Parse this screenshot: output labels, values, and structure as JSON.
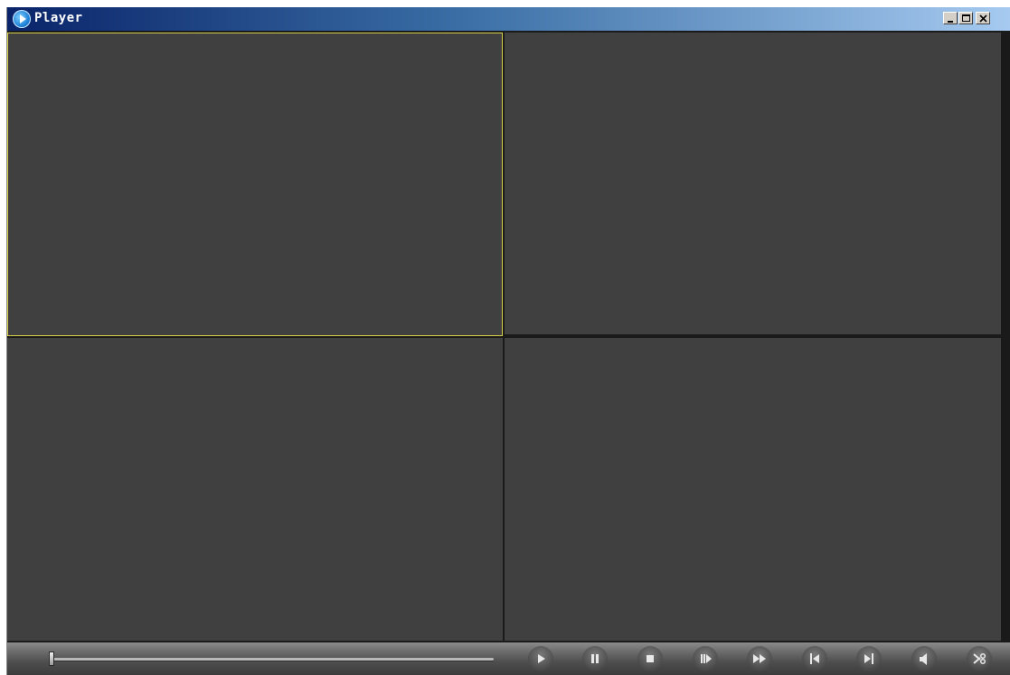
{
  "window": {
    "title": "Player",
    "icon": "player-app-icon",
    "buttons": [
      "minimize-icon",
      "maximize-icon",
      "close-icon"
    ]
  },
  "grid": {
    "cells": [
      {
        "name": "video-pane-1",
        "active": true
      },
      {
        "name": "video-pane-2",
        "active": false
      },
      {
        "name": "video-pane-3",
        "active": false
      },
      {
        "name": "video-pane-4",
        "active": false
      }
    ],
    "active_border_color": "#d8d24a",
    "pane_color": "#404040"
  },
  "controls": {
    "progress": 0.0,
    "buttons": [
      "play-icon",
      "pause-icon",
      "stop-icon",
      "step-forward-icon",
      "fast-forward-icon",
      "previous-icon",
      "next-icon",
      "volume-icon",
      "clip-icon"
    ]
  }
}
